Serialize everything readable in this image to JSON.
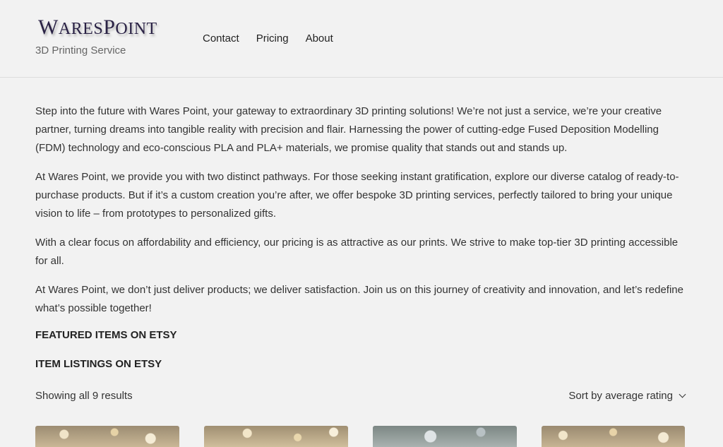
{
  "brand": {
    "logo_w": "W",
    "logo_ares": "ARES",
    "logo_p": "P",
    "logo_oint": "OINT",
    "tagline": "3D Printing Service"
  },
  "nav": {
    "items": [
      {
        "label": "Contact"
      },
      {
        "label": "Pricing"
      },
      {
        "label": "About"
      }
    ]
  },
  "content": {
    "paragraphs": [
      "Step into the future with Wares Point, your gateway to extraordinary 3D printing solutions! We’re not just a service, we’re your creative partner, turning dreams into tangible reality with precision and flair. Harnessing the power of cutting-edge Fused Deposition Modelling (FDM) technology and eco-conscious PLA and PLA+ materials, we promise quality that stands out and stands up.",
      "At Wares Point, we provide you with two distinct pathways. For those seeking instant gratification, explore our diverse catalog of ready-to-purchase products. But if it’s a custom creation you’re after, we offer bespoke 3D printing services, perfectly tailored to bring your unique vision to life – from prototypes to personalized gifts.",
      "With a clear focus on affordability and efficiency, our pricing is as attractive as our prints. We strive to make top-tier 3D printing accessible for all.",
      "At Wares Point, we don’t just deliver products; we deliver satisfaction. Join us on this journey of creativity and innovation, and let’s redefine what’s possible together!"
    ],
    "featured_heading": "FEATURED ITEMS ON ETSY",
    "listings_heading": "ITEM LISTINGS ON ETSY"
  },
  "shop": {
    "results_text": "Showing all 9 results",
    "sort_selected": "Sort by average rating"
  },
  "products": [
    {
      "image": "bokeh-product-photo-warm"
    },
    {
      "image": "bokeh-product-photo-warm"
    },
    {
      "image": "pine-product-photo-cool"
    },
    {
      "image": "bokeh-product-photo-warm"
    }
  ],
  "colors": {
    "background": "#f2f2f2",
    "logo": "#2a2245",
    "text": "#333333"
  }
}
